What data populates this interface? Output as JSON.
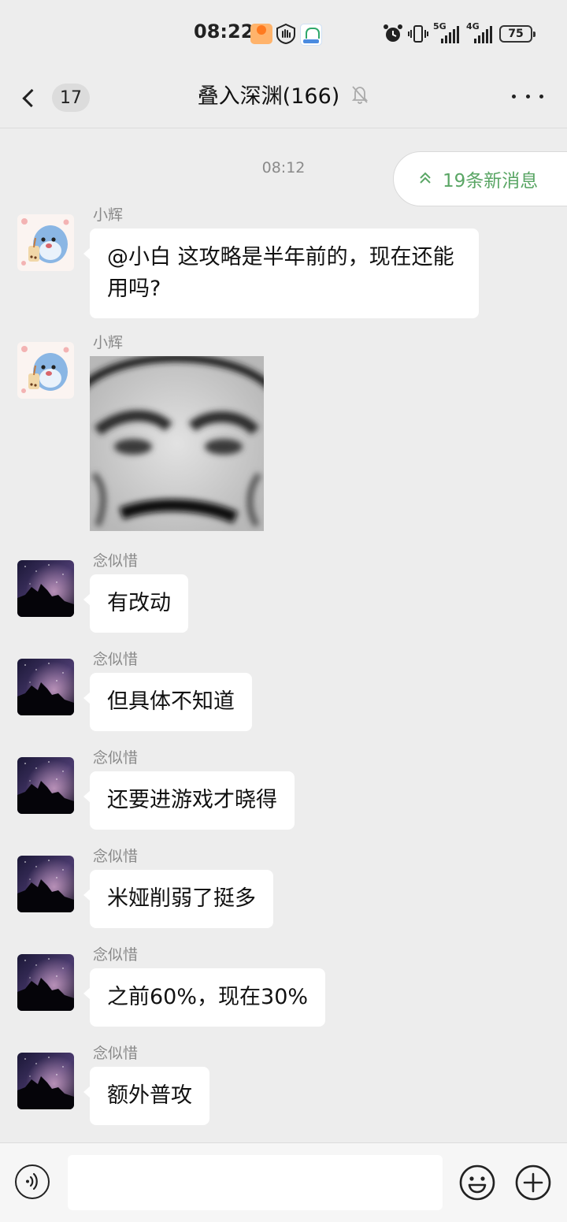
{
  "status_bar": {
    "time": "08:22",
    "signal_1": "5G",
    "signal_2": "4G",
    "battery": "75"
  },
  "header": {
    "unread_count": "17",
    "title": "叠入深渊(166)"
  },
  "timestamp": "08:12",
  "new_messages_label": "19条新消息",
  "messages": [
    {
      "sender": "小辉",
      "text": "@小白  这攻略是半年前的，现在还能用吗?"
    },
    {
      "sender": "小辉",
      "text": ""
    },
    {
      "sender": "念似惜",
      "text": "有改动"
    },
    {
      "sender": "念似惜",
      "text": "但具体不知道"
    },
    {
      "sender": "念似惜",
      "text": "还要进游戏才晓得"
    },
    {
      "sender": "念似惜",
      "text": "米娅削弱了挺多"
    },
    {
      "sender": "念似惜",
      "text": "之前60%，现在30%"
    },
    {
      "sender": "念似惜",
      "text": "额外普攻"
    }
  ],
  "colors": {
    "background": "#ededed",
    "bubble": "#ffffff",
    "accent_green": "#5aa665"
  },
  "icons": {
    "back": "chevron-left-icon",
    "mute": "bell-slash-icon",
    "more": "more-dots-icon",
    "new_messages": "double-chevron-up-icon",
    "voice": "voice-icon",
    "emoji": "emoji-icon",
    "plus": "plus-icon"
  }
}
